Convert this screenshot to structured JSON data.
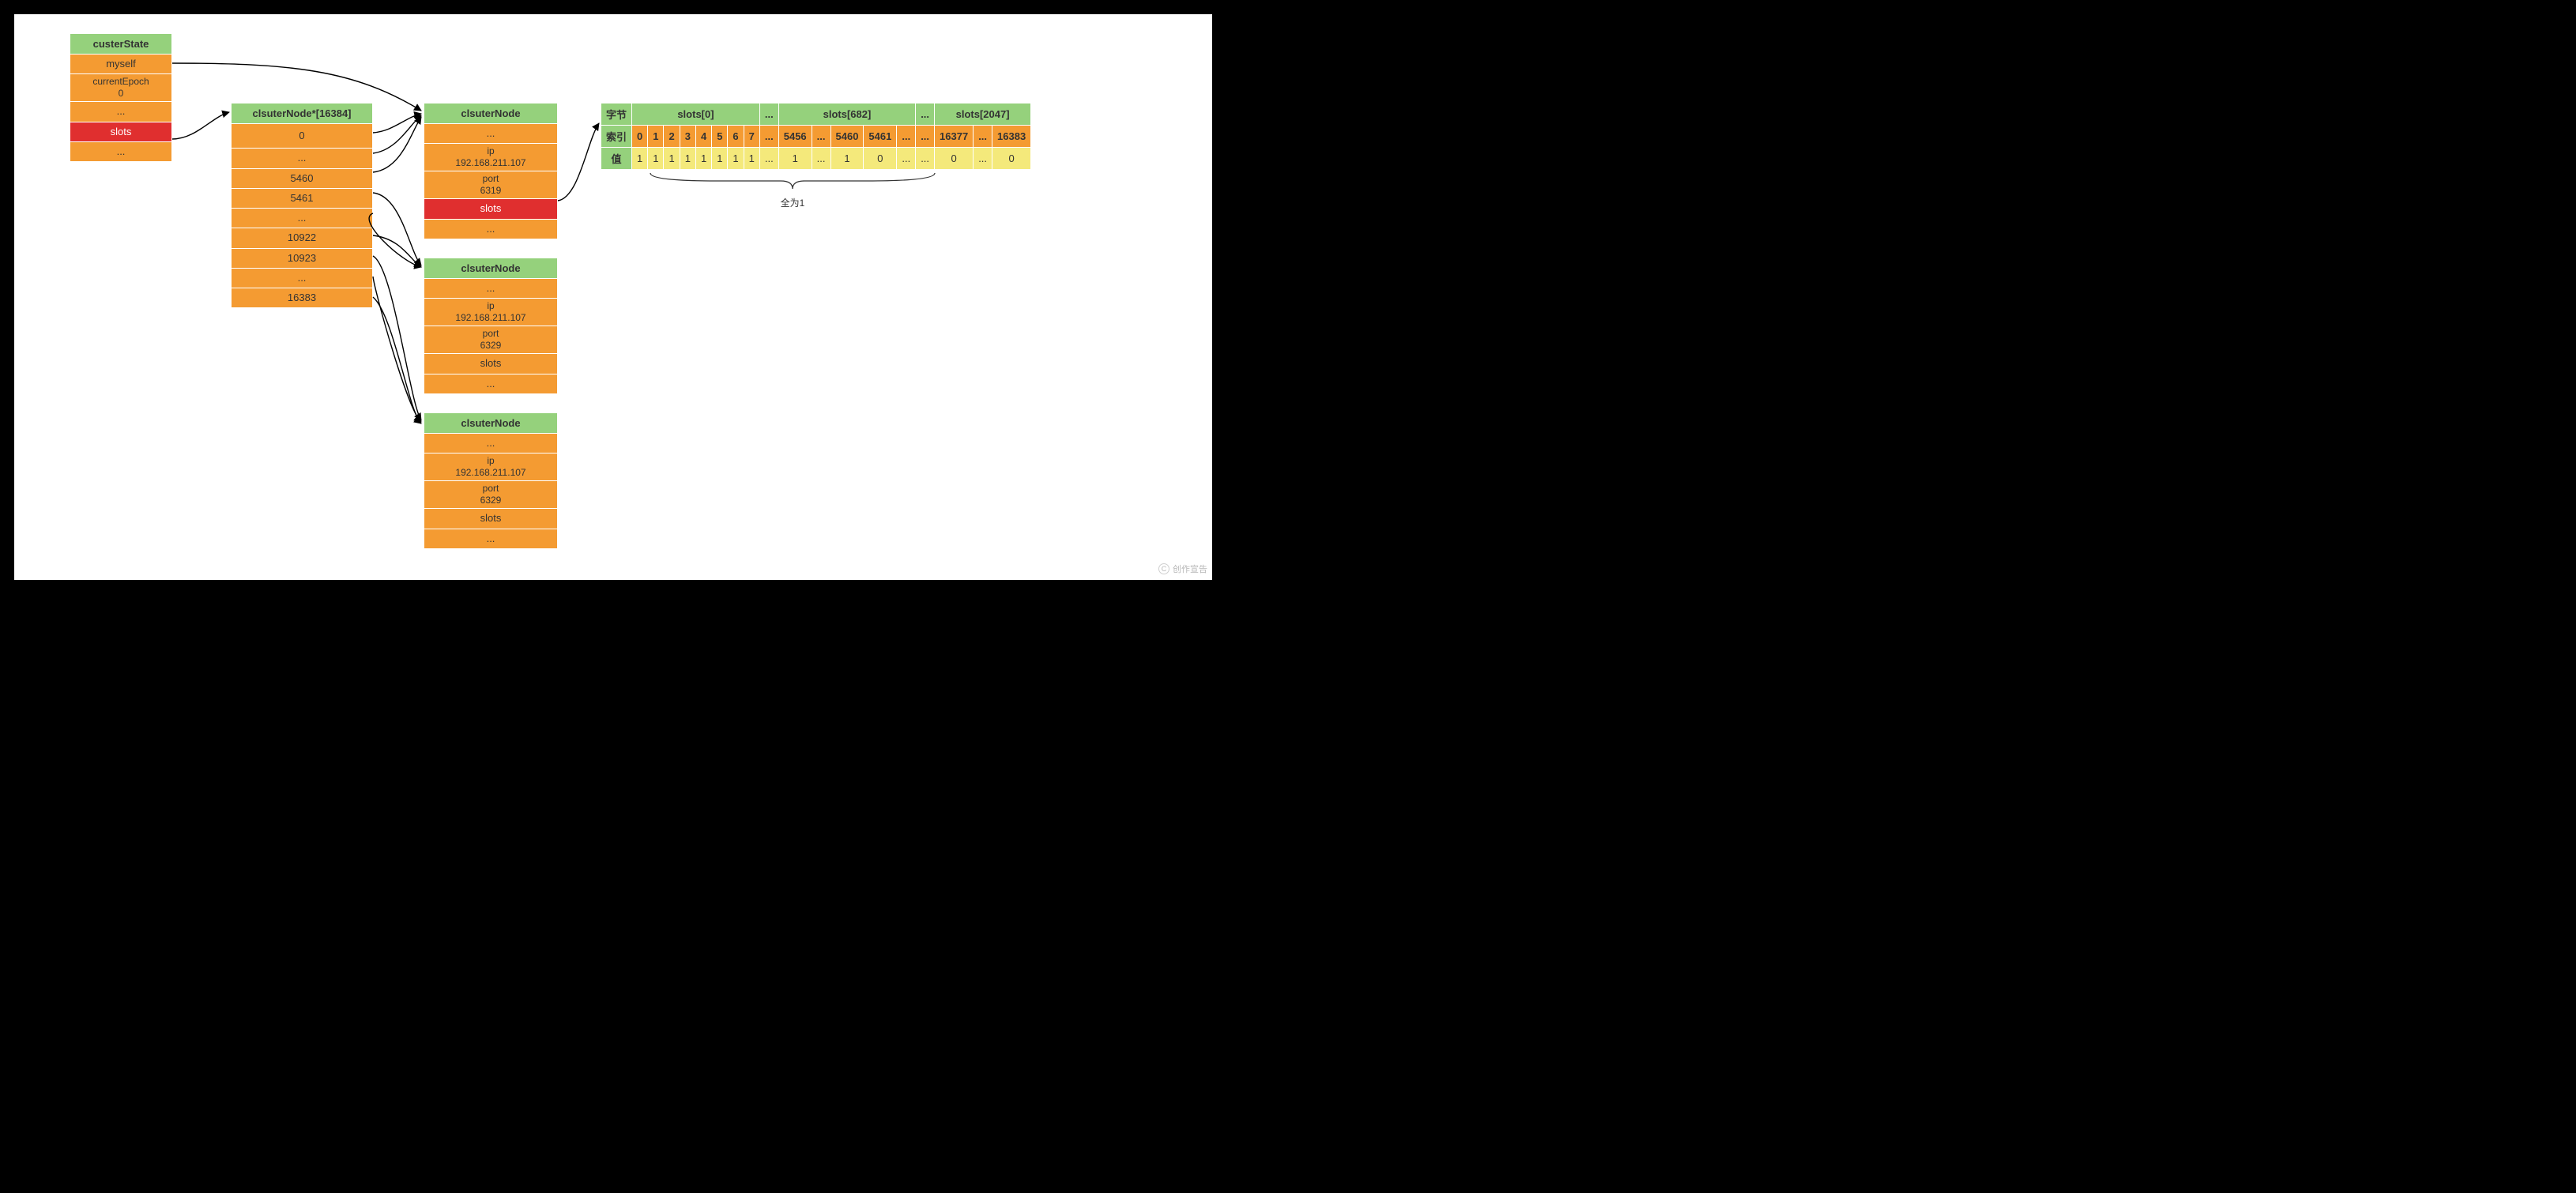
{
  "clusterState": {
    "title": "custerState",
    "rows": [
      {
        "label": "myself",
        "type": "orange"
      },
      {
        "label": "currentEpoch\n0",
        "type": "orange"
      },
      {
        "label": "...",
        "type": "orange"
      },
      {
        "label": "slots",
        "type": "red"
      },
      {
        "label": "...",
        "type": "orange"
      }
    ]
  },
  "slotsArray": {
    "title": "clsuterNode*[16384]",
    "rows": [
      "0",
      "...",
      "5460",
      "5461",
      "...",
      "10922",
      "10923",
      "...",
      "16383"
    ]
  },
  "nodes": [
    {
      "title": "clsuterNode",
      "rows": [
        {
          "label": "...",
          "type": "orange"
        },
        {
          "label": "ip\n192.168.211.107",
          "type": "orange"
        },
        {
          "label": "port\n6319",
          "type": "orange"
        },
        {
          "label": "slots",
          "type": "red"
        },
        {
          "label": "...",
          "type": "orange"
        }
      ]
    },
    {
      "title": "clsuterNode",
      "rows": [
        {
          "label": "...",
          "type": "orange"
        },
        {
          "label": "ip\n192.168.211.107",
          "type": "orange"
        },
        {
          "label": "port\n6329",
          "type": "orange"
        },
        {
          "label": "slots",
          "type": "orange"
        },
        {
          "label": "...",
          "type": "orange"
        }
      ]
    },
    {
      "title": "clsuterNode",
      "rows": [
        {
          "label": "...",
          "type": "orange"
        },
        {
          "label": "ip\n192.168.211.107",
          "type": "orange"
        },
        {
          "label": "port\n6329",
          "type": "orange"
        },
        {
          "label": "slots",
          "type": "orange"
        },
        {
          "label": "...",
          "type": "orange"
        }
      ]
    }
  ],
  "bitTable": {
    "rowLabels": [
      "字节",
      "索引",
      "值"
    ],
    "groups": [
      {
        "header": "slots[0]",
        "idx": [
          "0",
          "1",
          "2",
          "3",
          "4",
          "5",
          "6",
          "7"
        ],
        "val": [
          "1",
          "1",
          "1",
          "1",
          "1",
          "1",
          "1",
          "1"
        ]
      },
      {
        "header": "...",
        "idx": [
          "..."
        ],
        "val": [
          "..."
        ]
      },
      {
        "header": "slots[682]",
        "idx": [
          "5456",
          "...",
          "5460",
          "5461",
          "..."
        ],
        "val": [
          "1",
          "...",
          "1",
          "0",
          "..."
        ]
      },
      {
        "header": "...",
        "idx": [
          "..."
        ],
        "val": [
          "..."
        ]
      },
      {
        "header": "slots[2047]",
        "idx": [
          "16377",
          "...",
          "16383"
        ],
        "val": [
          "0",
          "...",
          "0"
        ]
      }
    ],
    "braceLabel": "全为1"
  },
  "watermark": "创作宣告"
}
